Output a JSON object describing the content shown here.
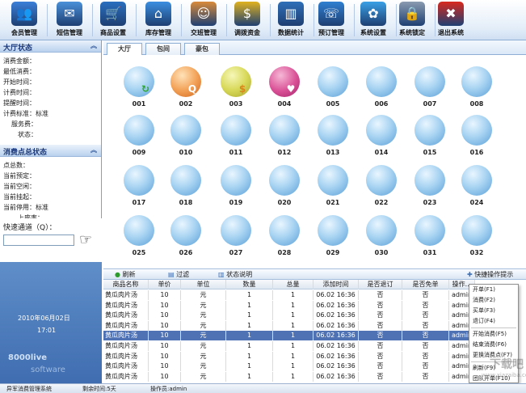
{
  "toolbar": [
    {
      "label": "会员管理",
      "icon": "members-icon",
      "color": "#3b7fd8"
    },
    {
      "label": "短信管理",
      "icon": "sms-icon",
      "color": "#4a90d9"
    },
    {
      "label": "商品设置",
      "icon": "cart-icon",
      "color": "#2a6fbf"
    },
    {
      "label": "库存管理",
      "icon": "home-icon",
      "color": "#3b8ee0"
    },
    {
      "label": "交班管理",
      "icon": "person-icon",
      "color": "#d98a3a"
    },
    {
      "label": "调拨资金",
      "icon": "coins-icon",
      "color": "#e0b21f"
    },
    {
      "label": "数据统计",
      "icon": "monitor-chart-icon",
      "color": "#2f6fb8"
    },
    {
      "label": "预订管理",
      "icon": "phone-icon",
      "color": "#2f7fd1"
    },
    {
      "label": "系统设置",
      "icon": "gear-icon",
      "color": "#3aa0e6"
    },
    {
      "label": "系统锁定",
      "icon": "lock-icon",
      "color": "#8a9bb0"
    },
    {
      "label": "退出系统",
      "icon": "exit-icon",
      "color": "#d8281e"
    }
  ],
  "hall_status": {
    "title": "大厅状态",
    "rows": [
      "消费金额：",
      "最低消费：",
      "开始时间：",
      "计费时间：",
      "提醒时间：",
      "计费标准：标准",
      "服务费：",
      "状态："
    ]
  },
  "consume_status": {
    "title": "消费点总状态",
    "rows": [
      "点总数：",
      "当前预定：",
      "当前空闲：",
      "当前挂起：",
      "当前停用：标准",
      "上座率："
    ]
  },
  "quick": {
    "title": "快速通道（Q）：",
    "value": ""
  },
  "datebox": {
    "date": "2010年06月02日",
    "time": "17:01",
    "brand1": "8000live",
    "brand2": "software"
  },
  "tabs": [
    "大厅",
    "包间",
    "豪包"
  ],
  "rooms": [
    {
      "num": "001",
      "state": "s1",
      "badge": "↻",
      "badge_color": "#2ea82e"
    },
    {
      "num": "002",
      "state": "s2",
      "badge": "Q",
      "badge_color": "#ffffff"
    },
    {
      "num": "003",
      "state": "s3",
      "badge": "$",
      "badge_color": "#d9851a"
    },
    {
      "num": "004",
      "state": "s4",
      "badge": "♥",
      "badge_color": "#ffffff"
    },
    {
      "num": "005",
      "state": "s0",
      "badge": "",
      "badge_color": ""
    },
    {
      "num": "006",
      "state": "s0",
      "badge": "",
      "badge_color": ""
    },
    {
      "num": "007",
      "state": "s0",
      "badge": "",
      "badge_color": ""
    },
    {
      "num": "008",
      "state": "s0",
      "badge": "",
      "badge_color": ""
    },
    {
      "num": "009",
      "state": "s0",
      "badge": "",
      "badge_color": ""
    },
    {
      "num": "010",
      "state": "s0",
      "badge": "",
      "badge_color": ""
    },
    {
      "num": "011",
      "state": "s0",
      "badge": "",
      "badge_color": ""
    },
    {
      "num": "012",
      "state": "s0",
      "badge": "",
      "badge_color": ""
    },
    {
      "num": "013",
      "state": "s0",
      "badge": "",
      "badge_color": ""
    },
    {
      "num": "014",
      "state": "s0",
      "badge": "",
      "badge_color": ""
    },
    {
      "num": "015",
      "state": "s0",
      "badge": "",
      "badge_color": ""
    },
    {
      "num": "016",
      "state": "s0",
      "badge": "",
      "badge_color": ""
    },
    {
      "num": "017",
      "state": "s0",
      "badge": "",
      "badge_color": ""
    },
    {
      "num": "018",
      "state": "s0",
      "badge": "",
      "badge_color": ""
    },
    {
      "num": "019",
      "state": "s0",
      "badge": "",
      "badge_color": ""
    },
    {
      "num": "020",
      "state": "s0",
      "badge": "",
      "badge_color": ""
    },
    {
      "num": "021",
      "state": "s0",
      "badge": "",
      "badge_color": ""
    },
    {
      "num": "022",
      "state": "s0",
      "badge": "",
      "badge_color": ""
    },
    {
      "num": "023",
      "state": "s0",
      "badge": "",
      "badge_color": ""
    },
    {
      "num": "024",
      "state": "s0",
      "badge": "",
      "badge_color": ""
    },
    {
      "num": "025",
      "state": "s0",
      "badge": "",
      "badge_color": ""
    },
    {
      "num": "026",
      "state": "s0",
      "badge": "",
      "badge_color": ""
    },
    {
      "num": "027",
      "state": "s0",
      "badge": "",
      "badge_color": ""
    },
    {
      "num": "028",
      "state": "s0",
      "badge": "",
      "badge_color": ""
    },
    {
      "num": "029",
      "state": "s0",
      "badge": "",
      "badge_color": ""
    },
    {
      "num": "030",
      "state": "s0",
      "badge": "",
      "badge_color": ""
    },
    {
      "num": "031",
      "state": "s0",
      "badge": "",
      "badge_color": ""
    },
    {
      "num": "032",
      "state": "s0",
      "badge": "",
      "badge_color": ""
    }
  ],
  "gridbar": {
    "refresh": "刷新",
    "filter": "过滤",
    "legend": "状态说明",
    "hint": "快捷操作提示"
  },
  "grid": {
    "columns": [
      "商品名称",
      "单价",
      "单位",
      "数量",
      "总量",
      "添加时间",
      "是否退订",
      "是否免单",
      "操作..."
    ],
    "rows": [
      [
        "黄瓜肉片汤",
        "10",
        "元",
        "1",
        "1",
        "06.02 16:36",
        "否",
        "否",
        "admin"
      ],
      [
        "黄瓜肉片汤",
        "10",
        "元",
        "1",
        "1",
        "06.02 16:36",
        "否",
        "否",
        "admin"
      ],
      [
        "黄瓜肉片汤",
        "10",
        "元",
        "1",
        "1",
        "06.02 16:36",
        "否",
        "否",
        "admin"
      ],
      [
        "黄瓜肉片汤",
        "10",
        "元",
        "1",
        "1",
        "06.02 16:36",
        "否",
        "否",
        "admin"
      ],
      [
        "黄瓜肉片汤",
        "10",
        "元",
        "1",
        "1",
        "06.02 16:36",
        "否",
        "否",
        "admin"
      ],
      [
        "黄瓜肉片汤",
        "10",
        "元",
        "1",
        "1",
        "06.02 16:36",
        "否",
        "否",
        "admin"
      ],
      [
        "黄瓜肉片汤",
        "10",
        "元",
        "1",
        "1",
        "06.02 16:36",
        "否",
        "否",
        "admin"
      ],
      [
        "黄瓜肉片汤",
        "10",
        "元",
        "1",
        "1",
        "06.02 16:36",
        "否",
        "否",
        "admin"
      ],
      [
        "黄瓜肉片汤",
        "10",
        "元",
        "1",
        "1",
        "06.02 16:36",
        "否",
        "否",
        "admin"
      ]
    ],
    "selected_row": 4
  },
  "context_menu": [
    "开单(F1)",
    "消费(F2)",
    "买单(F3)",
    "退订(F4)",
    "开始消费(F5)",
    "结束消费(F6)",
    "更换消费点(F7)",
    "刷新(F9)",
    "团队开单(F10)"
  ],
  "status": {
    "system": "异军消费管理系统",
    "remaining": "剩余时间:5天",
    "operator": "操作员:admin"
  },
  "watermark": {
    "line1": "下载吧",
    "line2": "www.xiazaiba.com"
  }
}
